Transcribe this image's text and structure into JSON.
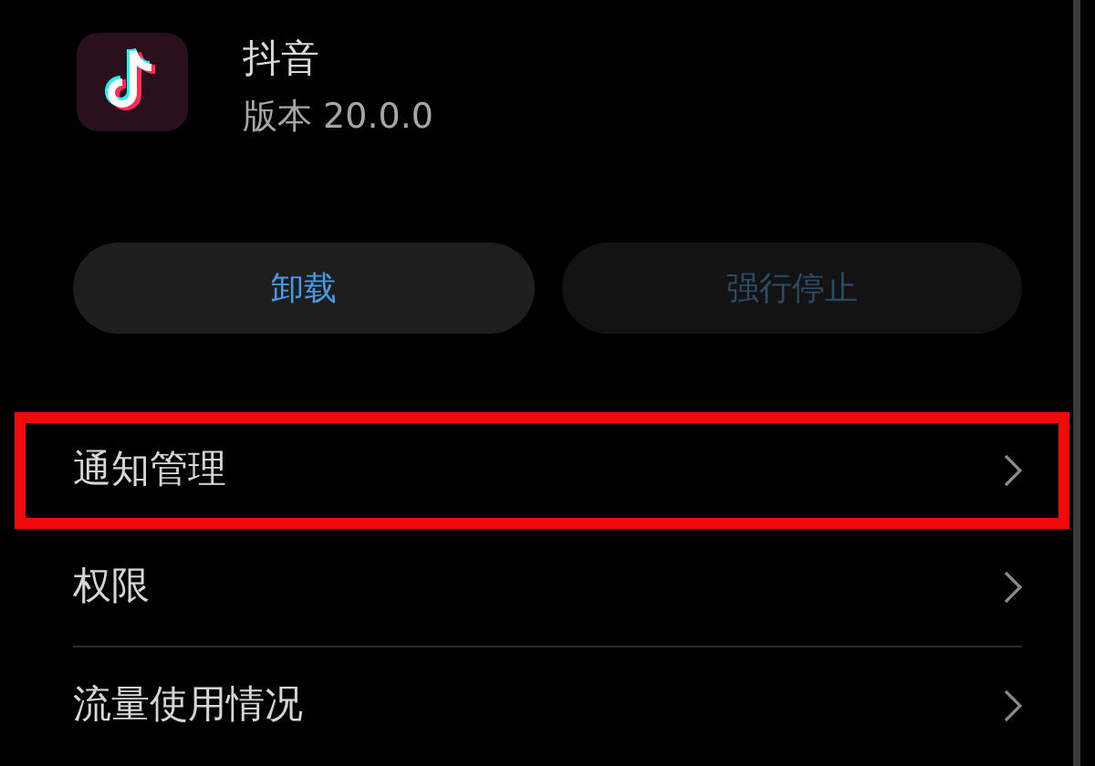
{
  "app": {
    "name": "抖音",
    "version": "版本 20.0.0"
  },
  "buttons": [
    {
      "label": "卸载",
      "disabled": false
    },
    {
      "label": "强行停止",
      "disabled": true
    }
  ],
  "menu": [
    {
      "label": "通知管理",
      "highlighted": true
    },
    {
      "label": "权限",
      "highlighted": false
    },
    {
      "label": "流量使用情况",
      "highlighted": false
    }
  ]
}
